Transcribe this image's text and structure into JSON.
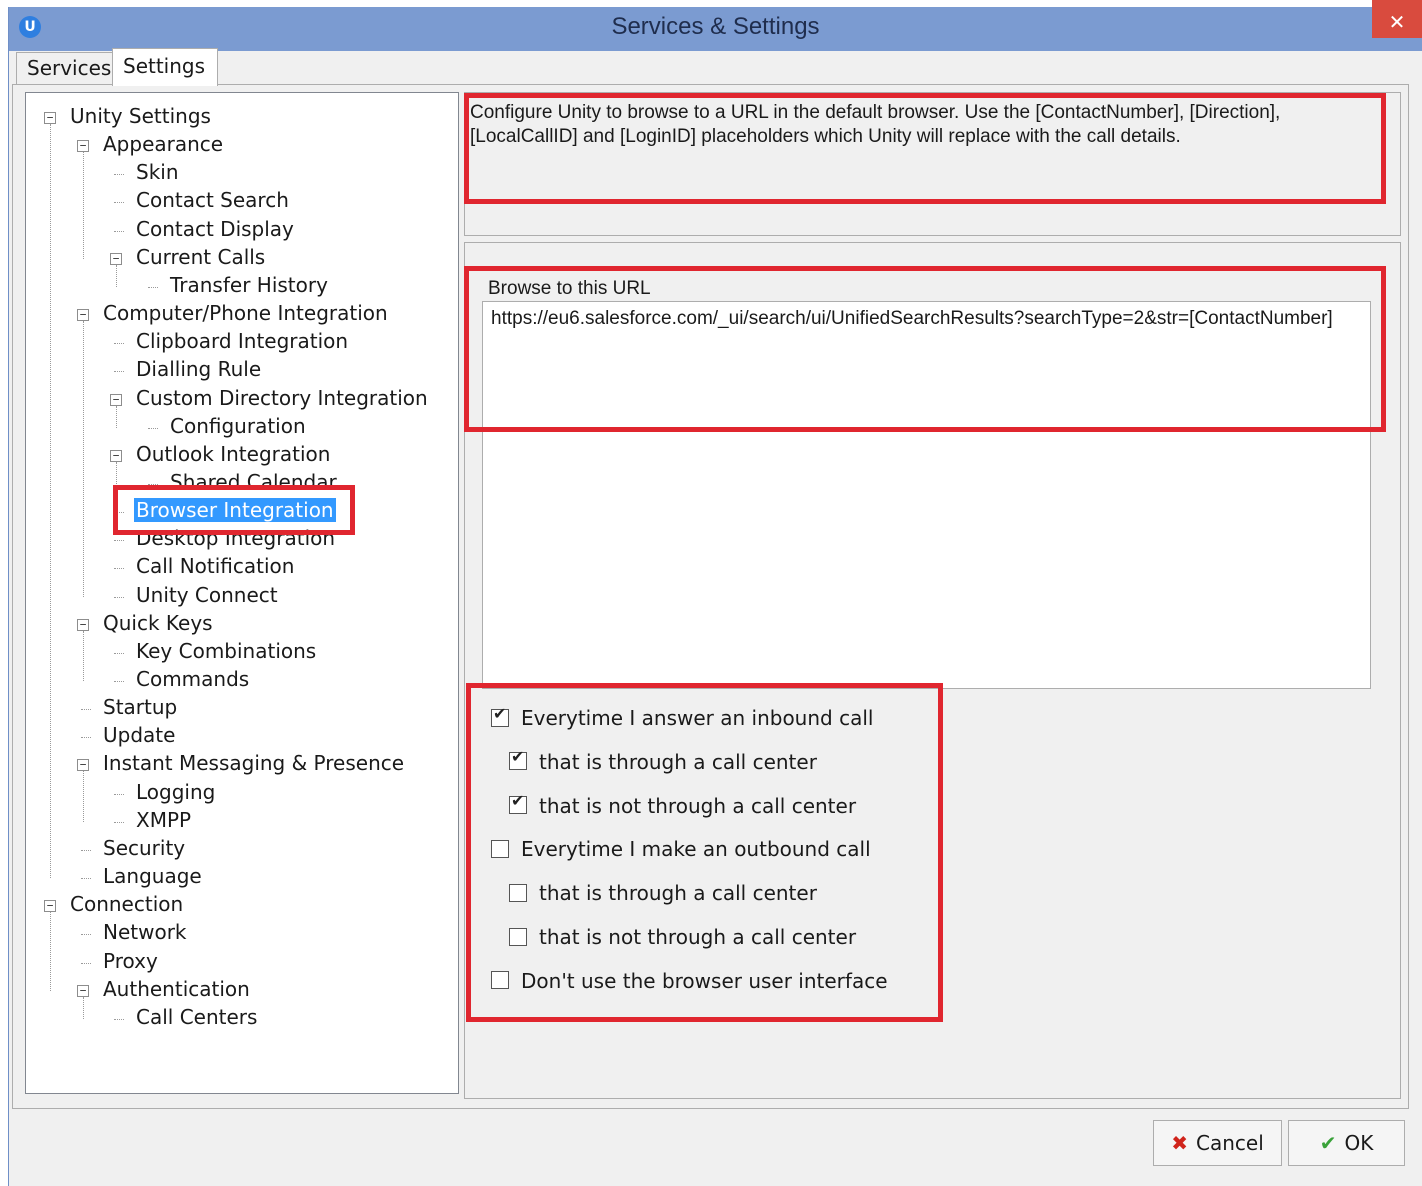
{
  "window": {
    "title": "Services & Settings",
    "app_icon": "U",
    "close_glyph": "✕"
  },
  "tabs": [
    {
      "label": "Services"
    },
    {
      "label": "Settings"
    }
  ],
  "tree": [
    {
      "label": "Unity Settings",
      "level": 0,
      "expanded": true
    },
    {
      "label": "Appearance",
      "level": 1,
      "expanded": true
    },
    {
      "label": "Skin",
      "level": 2
    },
    {
      "label": "Contact Search",
      "level": 2
    },
    {
      "label": "Contact Display",
      "level": 2
    },
    {
      "label": "Current Calls",
      "level": 2,
      "expanded": true
    },
    {
      "label": "Transfer History",
      "level": 3
    },
    {
      "label": "Computer/Phone Integration",
      "level": 1,
      "expanded": true
    },
    {
      "label": "Clipboard Integration",
      "level": 2
    },
    {
      "label": "Dialling Rule",
      "level": 2
    },
    {
      "label": "Custom Directory Integration",
      "level": 2,
      "expanded": true
    },
    {
      "label": "Configuration",
      "level": 3
    },
    {
      "label": "Outlook Integration",
      "level": 2,
      "expanded": true
    },
    {
      "label": "Shared Calendar",
      "level": 3
    },
    {
      "label": "Browser Integration",
      "level": 2,
      "selected": true
    },
    {
      "label": "Desktop Integration",
      "level": 2
    },
    {
      "label": "Call Notification",
      "level": 2
    },
    {
      "label": "Unity Connect",
      "level": 2
    },
    {
      "label": "Quick Keys",
      "level": 1,
      "expanded": true
    },
    {
      "label": "Key Combinations",
      "level": 2
    },
    {
      "label": "Commands",
      "level": 2
    },
    {
      "label": "Startup",
      "level": 1
    },
    {
      "label": "Update",
      "level": 1
    },
    {
      "label": "Instant Messaging & Presence",
      "level": 1,
      "expanded": true
    },
    {
      "label": "Logging",
      "level": 2
    },
    {
      "label": "XMPP",
      "level": 2
    },
    {
      "label": "Security",
      "level": 1
    },
    {
      "label": "Language",
      "level": 1
    },
    {
      "label": "Connection",
      "level": 0,
      "expanded": true
    },
    {
      "label": "Network",
      "level": 1
    },
    {
      "label": "Proxy",
      "level": 1
    },
    {
      "label": "Authentication",
      "level": 1,
      "expanded": true
    },
    {
      "label": "Call Centers",
      "level": 2
    }
  ],
  "panel": {
    "description": "Configure Unity to browse to a URL in the default browser.  Use the [ContactNumber], [Direction], [LocalCallID] and [LoginID] placeholders which Unity will replace with the call details.",
    "url_label": "Browse to this URL",
    "url_value": "https://eu6.salesforce.com/_ui/search/ui/UnifiedSearchResults?searchType=2&str=[ContactNumber]",
    "options": [
      {
        "label": "Everytime I answer an inbound call",
        "checked": true,
        "indent": 0
      },
      {
        "label": "that is through a call center",
        "checked": true,
        "indent": 1
      },
      {
        "label": "that is not through a call center",
        "checked": true,
        "indent": 1
      },
      {
        "label": "Everytime I make an outbound call",
        "checked": false,
        "indent": 0
      },
      {
        "label": "that is through a call center",
        "checked": false,
        "indent": 1
      },
      {
        "label": "that is not through a call center",
        "checked": false,
        "indent": 1
      },
      {
        "label": "Don't use the browser user interface",
        "checked": false,
        "indent": 0
      }
    ]
  },
  "buttons": {
    "cancel": {
      "label": "Cancel",
      "icon": "✖"
    },
    "ok": {
      "label": "OK",
      "icon": "✔"
    }
  },
  "colors": {
    "titlebar": "#7b9bd1",
    "highlight": "#e0262f",
    "selection": "#3399ff"
  }
}
